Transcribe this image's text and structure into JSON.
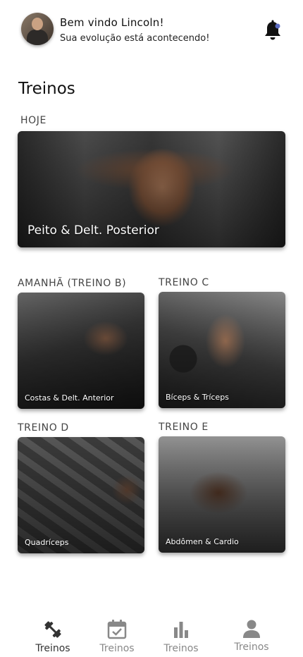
{
  "header": {
    "greeting": "Bem vindo Lincoln!",
    "subtitle": "Sua evolução está acontecendo!",
    "notification_icon": "bell-icon",
    "notification_dot_color": "#5c6bc0"
  },
  "page": {
    "title": "Treinos"
  },
  "today": {
    "label": "HOJE",
    "card_title": "Peito & Delt. Posterior"
  },
  "workouts": [
    {
      "label": "AMANHÃ (TREINO B)",
      "card_title": "Costas & Delt. Anterior"
    },
    {
      "label": "TREINO C",
      "card_title": "Bíceps & Tríceps"
    },
    {
      "label": "TREINO D",
      "card_title": "Quadríceps"
    },
    {
      "label": "TREINO E",
      "card_title": "Abdômen & Cardio"
    }
  ],
  "nav": [
    {
      "label": "Treinos",
      "icon": "dumbbell-icon",
      "active": true
    },
    {
      "label": "Treinos",
      "icon": "calendar-check-icon",
      "active": false
    },
    {
      "label": "Treinos",
      "icon": "bar-chart-icon",
      "active": false
    },
    {
      "label": "Treinos",
      "icon": "person-icon",
      "active": false
    }
  ]
}
